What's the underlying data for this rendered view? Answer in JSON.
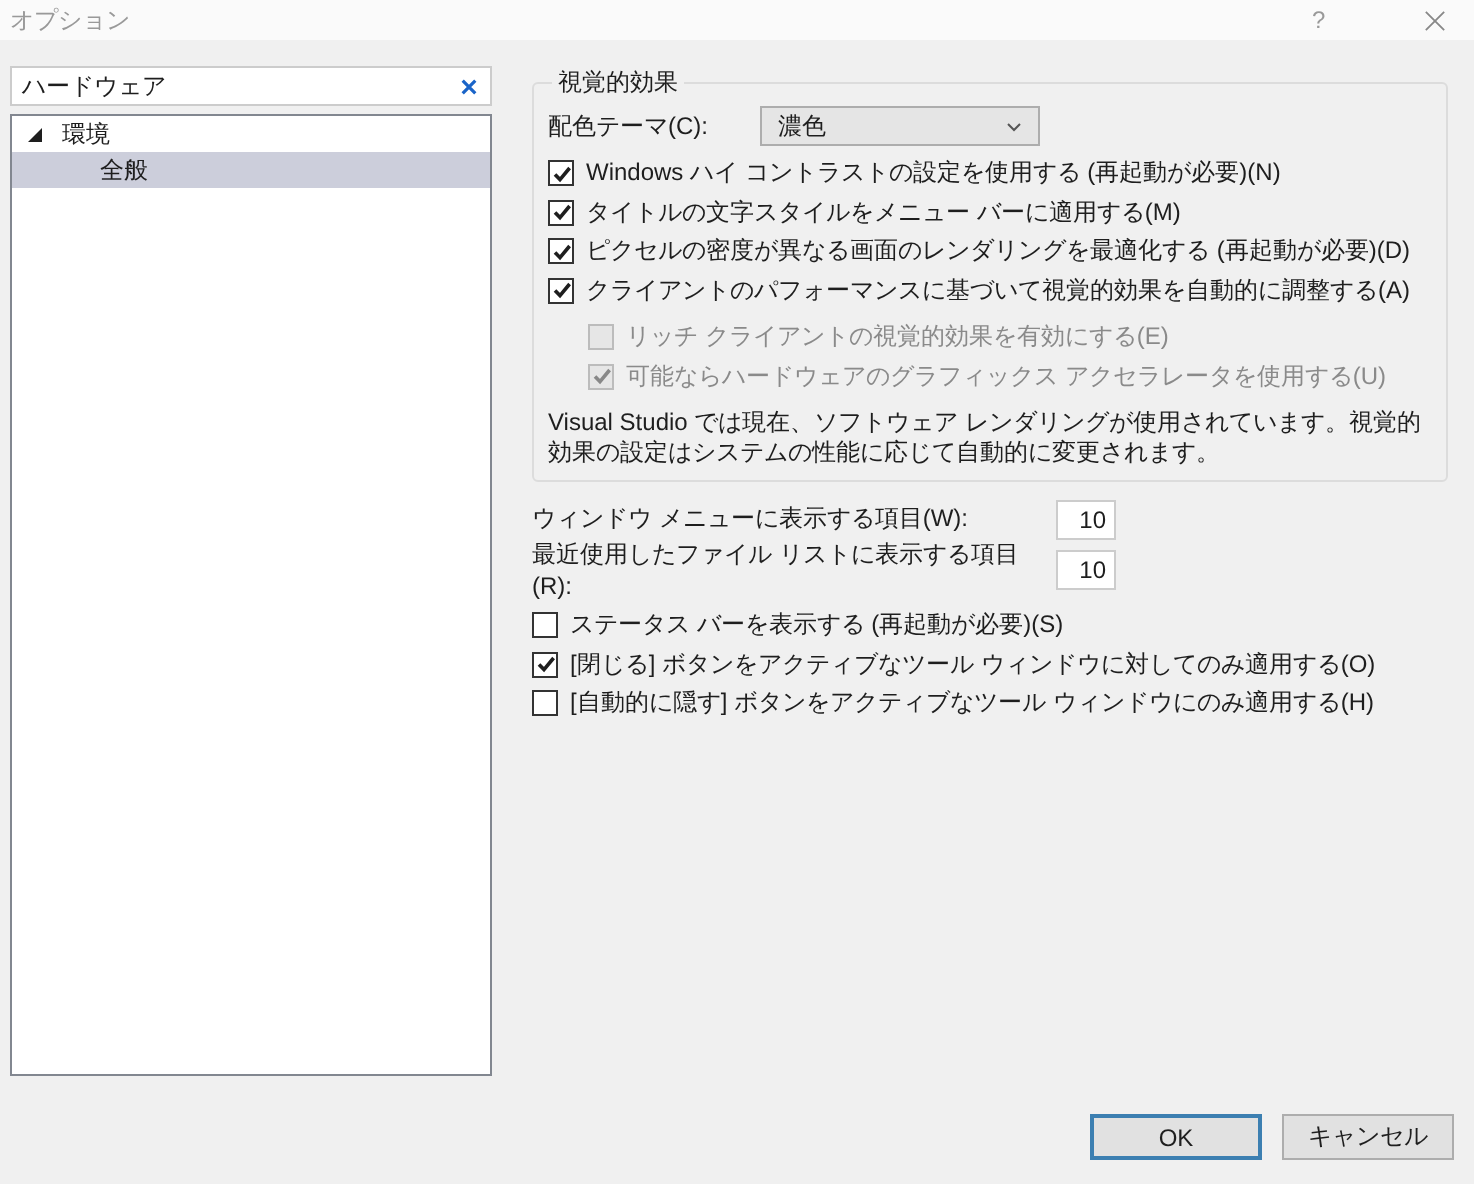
{
  "window": {
    "title": "オプション",
    "help": "?"
  },
  "search": {
    "value": "ハードウェア"
  },
  "tree": [
    {
      "label": "環境",
      "expanded": true,
      "selected": false,
      "children": [
        {
          "label": "全般",
          "selected": true
        }
      ]
    }
  ],
  "visual_effects": {
    "title": "視覚的効果",
    "color_theme": {
      "label": "配色テーマ(C):",
      "value": "濃色"
    },
    "options": [
      {
        "label": "Windows ハイ コントラストの設定を使用する (再起動が必要)(N)",
        "checked": true,
        "disabled": false
      },
      {
        "label": "タイトルの文字スタイルをメニュー バーに適用する(M)",
        "checked": true,
        "disabled": false
      },
      {
        "label": "ピクセルの密度が異なる画面のレンダリングを最適化する (再起動が必要)(D)",
        "checked": true,
        "disabled": false
      },
      {
        "label": "クライアントのパフォーマンスに基づいて視覚的効果を自動的に調整する(A)",
        "checked": true,
        "disabled": false,
        "children": [
          {
            "label": "リッチ クライアントの視覚的効果を有効にする(E)",
            "checked": false,
            "disabled": true
          },
          {
            "label": "可能ならハードウェアのグラフィックス アクセラレータを使用する(U)",
            "checked": true,
            "disabled": true
          }
        ]
      }
    ],
    "info": "Visual Studio では現在、ソフトウェア レンダリングが使用されています。視覚的効果の設定はシステムの性能に応じて自動的に変更されます。"
  },
  "number_fields": [
    {
      "label": "ウィンドウ メニューに表示する項目(W):",
      "value": "10"
    },
    {
      "label": "最近使用したファイル リストに表示する項目(R):",
      "value": "10"
    }
  ],
  "options": [
    {
      "label": "ステータス バーを表示する (再起動が必要)(S)",
      "checked": false,
      "disabled": false
    },
    {
      "label": "[閉じる] ボタンをアクティブなツール ウィンドウに対してのみ適用する(O)",
      "checked": true,
      "disabled": false
    },
    {
      "label": "[自動的に隠す] ボタンをアクティブなツール ウィンドウにのみ適用する(H)",
      "checked": false,
      "disabled": false
    }
  ],
  "buttons": [
    {
      "label": "OK",
      "default": true
    },
    {
      "label": "キャンセル",
      "default": false
    }
  ]
}
